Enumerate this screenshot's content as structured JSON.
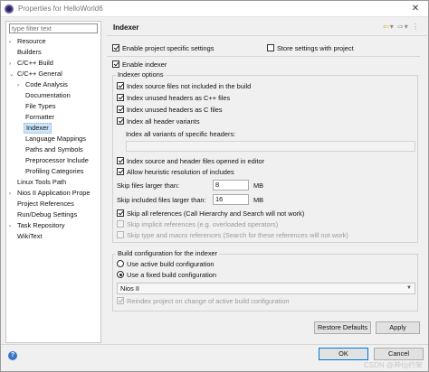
{
  "window": {
    "title": "Properties for HelloWorld6",
    "close": "✕",
    "help": "?"
  },
  "sidebar": {
    "filter_placeholder": "type filter text",
    "items": [
      {
        "label": "Resource",
        "arrow": "›"
      },
      {
        "label": "Builders",
        "arrow": ""
      },
      {
        "label": "C/C++ Build",
        "arrow": "›"
      },
      {
        "label": "C/C++ General",
        "arrow": "⌄"
      },
      {
        "label": "Code Analysis",
        "arrow": "›"
      },
      {
        "label": "Documentation",
        "arrow": ""
      },
      {
        "label": "File Types",
        "arrow": ""
      },
      {
        "label": "Formatter",
        "arrow": ""
      },
      {
        "label": "Indexer",
        "arrow": ""
      },
      {
        "label": "Language Mappings",
        "arrow": ""
      },
      {
        "label": "Paths and Symbols",
        "arrow": ""
      },
      {
        "label": "Preprocessor Include",
        "arrow": ""
      },
      {
        "label": "Profiling Categories",
        "arrow": ""
      },
      {
        "label": "Linux Tools Path",
        "arrow": ""
      },
      {
        "label": "Nios II Application Prope",
        "arrow": "›"
      },
      {
        "label": "Project References",
        "arrow": ""
      },
      {
        "label": "Run/Debug Settings",
        "arrow": ""
      },
      {
        "label": "Task Repository",
        "arrow": "›"
      },
      {
        "label": "WikiText",
        "arrow": ""
      }
    ]
  },
  "page": {
    "title": "Indexer",
    "nav_back": "⇦",
    "nav_forward": "⇨",
    "nav_menu": "▾",
    "enable_project_specific": "Enable project specific settings",
    "store_with_project": "Store settings with project",
    "enable_indexer": "Enable indexer",
    "indexer_options_label": "Indexer options",
    "opt_files_not_in_build": "Index source files not included in the build",
    "opt_unused_cpp_headers": "Index unused headers as C++ files",
    "opt_unused_c_headers": "Index unused headers as C files",
    "opt_all_header_variants": "Index all header variants",
    "specific_headers_label": "Index all variants of specific headers:",
    "specific_headers_value": "",
    "opt_files_open_in_editor": "Index source and header files opened in editor",
    "opt_heuristic": "Allow heuristic resolution of includes",
    "skip_larger_label": "Skip files larger than:",
    "skip_larger_value": "8",
    "skip_larger_unit": "MB",
    "skip_included_label": "Skip included files larger than:",
    "skip_included_value": "16",
    "skip_included_unit": "MB",
    "skip_all_refs": "Skip all references (Call Hierarchy and Search will not work)",
    "skip_implicit_refs": "Skip implicit references (e.g. overloaded operators)",
    "skip_type_macro_refs": "Skip type and macro references (Search for these references will not work)",
    "build_config_label": "Build configuration for the indexer",
    "use_active_config": "Use active build configuration",
    "use_fixed_config": "Use a fixed build configuration",
    "fixed_config_value": "Nios II",
    "reindex_on_change": "Reindex project on change of active build configuration",
    "restore_defaults": "Restore Defaults",
    "apply": "Apply"
  },
  "buttons": {
    "ok": "OK",
    "cancel": "Cancel"
  },
  "watermark": "CSDN @神仙约架"
}
